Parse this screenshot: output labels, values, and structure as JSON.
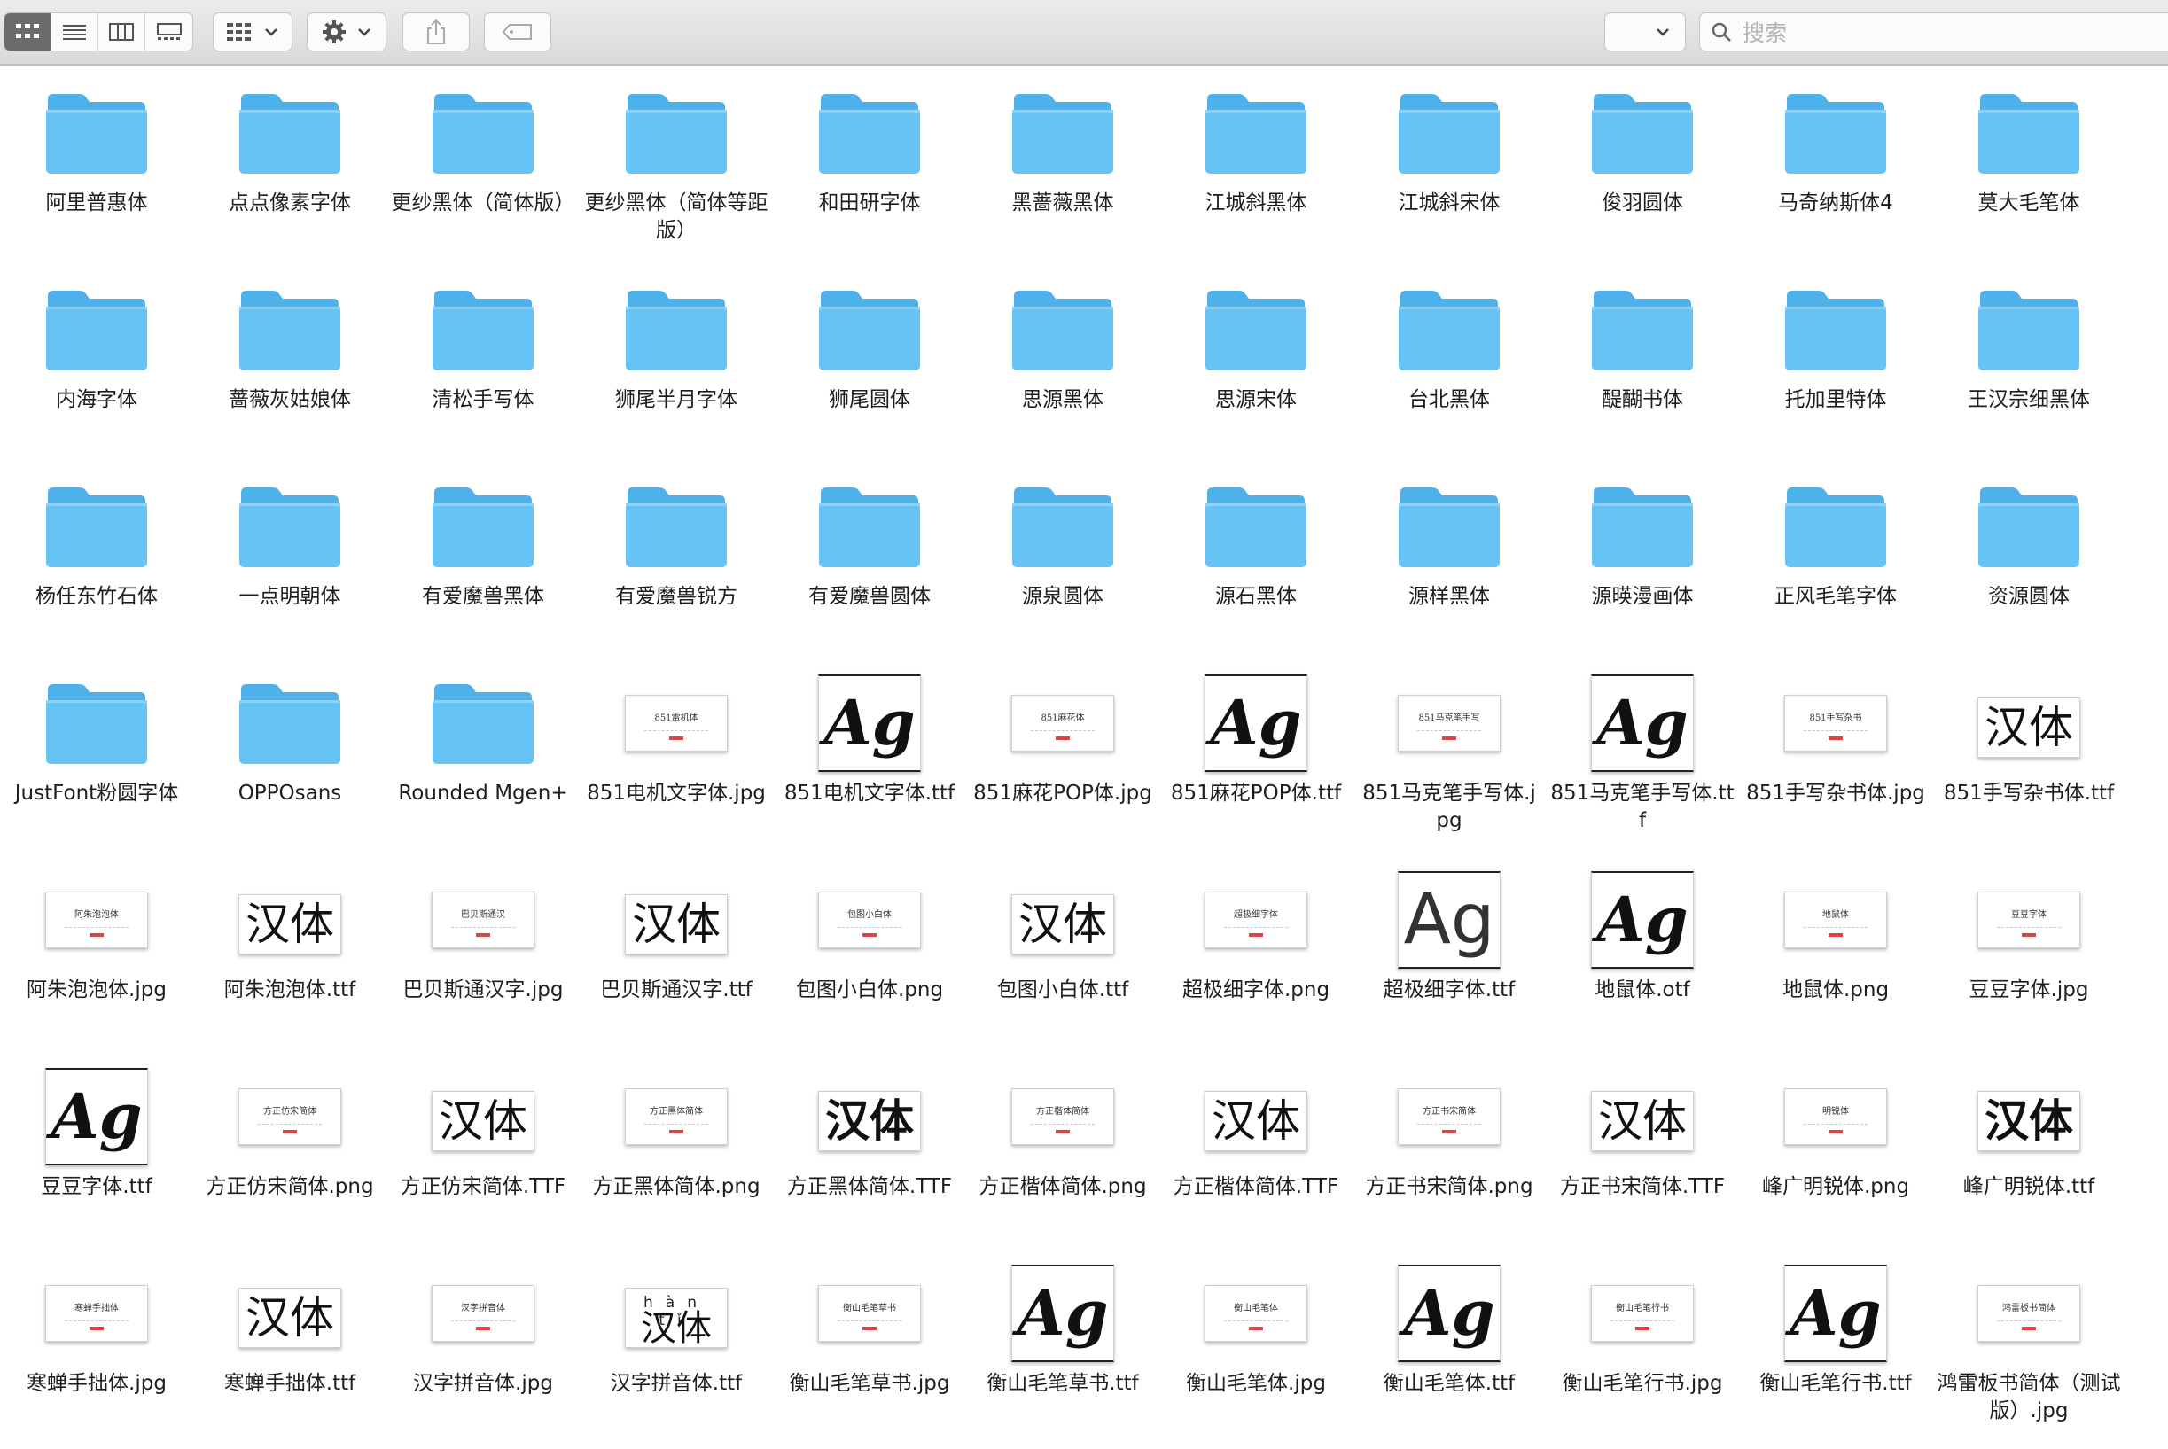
{
  "toolbar": {
    "search_placeholder": "搜索",
    "icons": [
      "icon-view-grid",
      "list-view-icon",
      "column-view-icon",
      "gallery-view-icon",
      "group-by-icon",
      "gear-icon",
      "share-icon",
      "tag-icon",
      "chevron-down-icon",
      "search-icon"
    ]
  },
  "colors": {
    "folder_body": "#66c3f5",
    "folder_tab": "#4fb1ea",
    "accent_logo": "#e04343"
  },
  "items": [
    {
      "kind": "folder",
      "name": "阿里普惠体"
    },
    {
      "kind": "folder",
      "name": "点点像素字体"
    },
    {
      "kind": "folder",
      "name": "更纱黑体（简体版）"
    },
    {
      "kind": "folder",
      "name": "更纱黑体（简体等距版）"
    },
    {
      "kind": "folder",
      "name": "和田研字体"
    },
    {
      "kind": "folder",
      "name": "黑蔷薇黑体"
    },
    {
      "kind": "folder",
      "name": "江城斜黑体"
    },
    {
      "kind": "folder",
      "name": "江城斜宋体"
    },
    {
      "kind": "folder",
      "name": "俊羽圆体"
    },
    {
      "kind": "folder",
      "name": "马奇纳斯体4"
    },
    {
      "kind": "folder",
      "name": "莫大毛笔体"
    },
    {
      "kind": "folder",
      "name": "内海字体"
    },
    {
      "kind": "folder",
      "name": "蔷薇灰姑娘体"
    },
    {
      "kind": "folder",
      "name": "清松手写体"
    },
    {
      "kind": "folder",
      "name": "狮尾半月字体"
    },
    {
      "kind": "folder",
      "name": "狮尾圆体"
    },
    {
      "kind": "folder",
      "name": "思源黑体"
    },
    {
      "kind": "folder",
      "name": "思源宋体"
    },
    {
      "kind": "folder",
      "name": "台北黑体"
    },
    {
      "kind": "folder",
      "name": "醍醐书体"
    },
    {
      "kind": "folder",
      "name": "托加里特体"
    },
    {
      "kind": "folder",
      "name": "王汉宗细黑体"
    },
    {
      "kind": "folder",
      "name": "杨任东竹石体"
    },
    {
      "kind": "folder",
      "name": "一点明朝体"
    },
    {
      "kind": "folder",
      "name": "有爱魔兽黑体"
    },
    {
      "kind": "folder",
      "name": "有爱魔兽锐方"
    },
    {
      "kind": "folder",
      "name": "有爱魔兽圆体"
    },
    {
      "kind": "folder",
      "name": "源泉圆体"
    },
    {
      "kind": "folder",
      "name": "源石黑体"
    },
    {
      "kind": "folder",
      "name": "源样黑体"
    },
    {
      "kind": "folder",
      "name": "源暎漫画体"
    },
    {
      "kind": "folder",
      "name": "正风毛笔字体"
    },
    {
      "kind": "folder",
      "name": "资源圆体"
    },
    {
      "kind": "folder",
      "name": "JustFont粉圆字体"
    },
    {
      "kind": "folder",
      "name": "OPPOsans"
    },
    {
      "kind": "folder",
      "name": "Rounded Mgen+"
    },
    {
      "kind": "jpg",
      "name": "851电机文字体.jpg",
      "thumb": "851電机体"
    },
    {
      "kind": "ttf-ag",
      "name": "851电机文字体.ttf",
      "glyph": "Ag"
    },
    {
      "kind": "jpg",
      "name": "851麻花POP体.jpg",
      "thumb": "851麻花体"
    },
    {
      "kind": "ttf-ag",
      "name": "851麻花POP体.ttf",
      "glyph": "Ag"
    },
    {
      "kind": "jpg",
      "name": "851马克笔手写体.jpg",
      "thumb": "851马克笔手写"
    },
    {
      "kind": "ttf-ag",
      "name": "851马克笔手写体.ttf",
      "glyph": "Ag"
    },
    {
      "kind": "jpg",
      "name": "851手写杂书体.jpg",
      "thumb": "851手写杂书"
    },
    {
      "kind": "ttf-han",
      "name": "851手写杂书体.ttf",
      "glyph": "汉体"
    },
    {
      "kind": "jpg",
      "name": "阿朱泡泡体.jpg",
      "thumb": "阿朱泡泡体"
    },
    {
      "kind": "ttf-han",
      "name": "阿朱泡泡体.ttf",
      "glyph": "汉体"
    },
    {
      "kind": "jpg",
      "name": "巴贝斯通汉字.jpg",
      "thumb": "巴贝斯通汉"
    },
    {
      "kind": "ttf-han",
      "name": "巴贝斯通汉字.ttf",
      "glyph": "汉体"
    },
    {
      "kind": "jpg",
      "name": "包图小白体.png",
      "thumb": "包图小白体"
    },
    {
      "kind": "ttf-han",
      "name": "包图小白体.ttf",
      "glyph": "汉体"
    },
    {
      "kind": "jpg",
      "name": "超极细字体.png",
      "thumb": "超极细字体"
    },
    {
      "kind": "ttf-ag",
      "name": "超极细字体.ttf",
      "glyph": "Ag"
    },
    {
      "kind": "ttf-ag",
      "name": "地鼠体.otf",
      "glyph": "Ag"
    },
    {
      "kind": "jpg",
      "name": "地鼠体.png",
      "thumb": "地鼠体"
    },
    {
      "kind": "jpg",
      "name": "豆豆字体.jpg",
      "thumb": "豆豆字体"
    },
    {
      "kind": "ttf-ag",
      "name": "豆豆字体.ttf",
      "glyph": "Ag"
    },
    {
      "kind": "jpg",
      "name": "方正仿宋简体.png",
      "thumb": "方正仿宋简体"
    },
    {
      "kind": "ttf-han",
      "name": "方正仿宋简体.TTF",
      "glyph": "汉体"
    },
    {
      "kind": "jpg",
      "name": "方正黑体简体.png",
      "thumb": "方正黑体简体"
    },
    {
      "kind": "ttf-han",
      "name": "方正黑体简体.TTF",
      "glyph": "汉体"
    },
    {
      "kind": "jpg",
      "name": "方正楷体简体.png",
      "thumb": "方正楷体简体"
    },
    {
      "kind": "ttf-han",
      "name": "方正楷体简体.TTF",
      "glyph": "汉体"
    },
    {
      "kind": "jpg",
      "name": "方正书宋简体.png",
      "thumb": "方正书宋简体"
    },
    {
      "kind": "ttf-han",
      "name": "方正书宋简体.TTF",
      "glyph": "汉体"
    },
    {
      "kind": "jpg",
      "name": "峰广明锐体.png",
      "thumb": "明锐体"
    },
    {
      "kind": "ttf-han",
      "name": "峰广明锐体.ttf",
      "glyph": "汉体"
    },
    {
      "kind": "jpg",
      "name": "寒蝉手拙体.jpg",
      "thumb": "寒蝉手拙体"
    },
    {
      "kind": "ttf-han",
      "name": "寒蝉手拙体.ttf",
      "glyph": "汉体"
    },
    {
      "kind": "jpg",
      "name": "汉字拼音体.jpg",
      "thumb": "汉字拼音体"
    },
    {
      "kind": "ttf-py",
      "name": "汉字拼音体.ttf",
      "glyph": "汉体",
      "pinyin": "hàn tǐ"
    },
    {
      "kind": "jpg",
      "name": "衡山毛笔草书.jpg",
      "thumb": "衡山毛笔草书"
    },
    {
      "kind": "ttf-ag",
      "name": "衡山毛笔草书.ttf",
      "glyph": "Ag"
    },
    {
      "kind": "jpg",
      "name": "衡山毛笔体.jpg",
      "thumb": "衡山毛笔体"
    },
    {
      "kind": "ttf-ag",
      "name": "衡山毛笔体.ttf",
      "glyph": "Ag"
    },
    {
      "kind": "jpg",
      "name": "衡山毛笔行书.jpg",
      "thumb": "衡山毛笔行书"
    },
    {
      "kind": "ttf-ag",
      "name": "衡山毛笔行书.ttf",
      "glyph": "Ag"
    },
    {
      "kind": "jpg",
      "name": "鸿雷板书简体（测试版）.jpg",
      "thumb": "鸿雷板书简体"
    }
  ]
}
